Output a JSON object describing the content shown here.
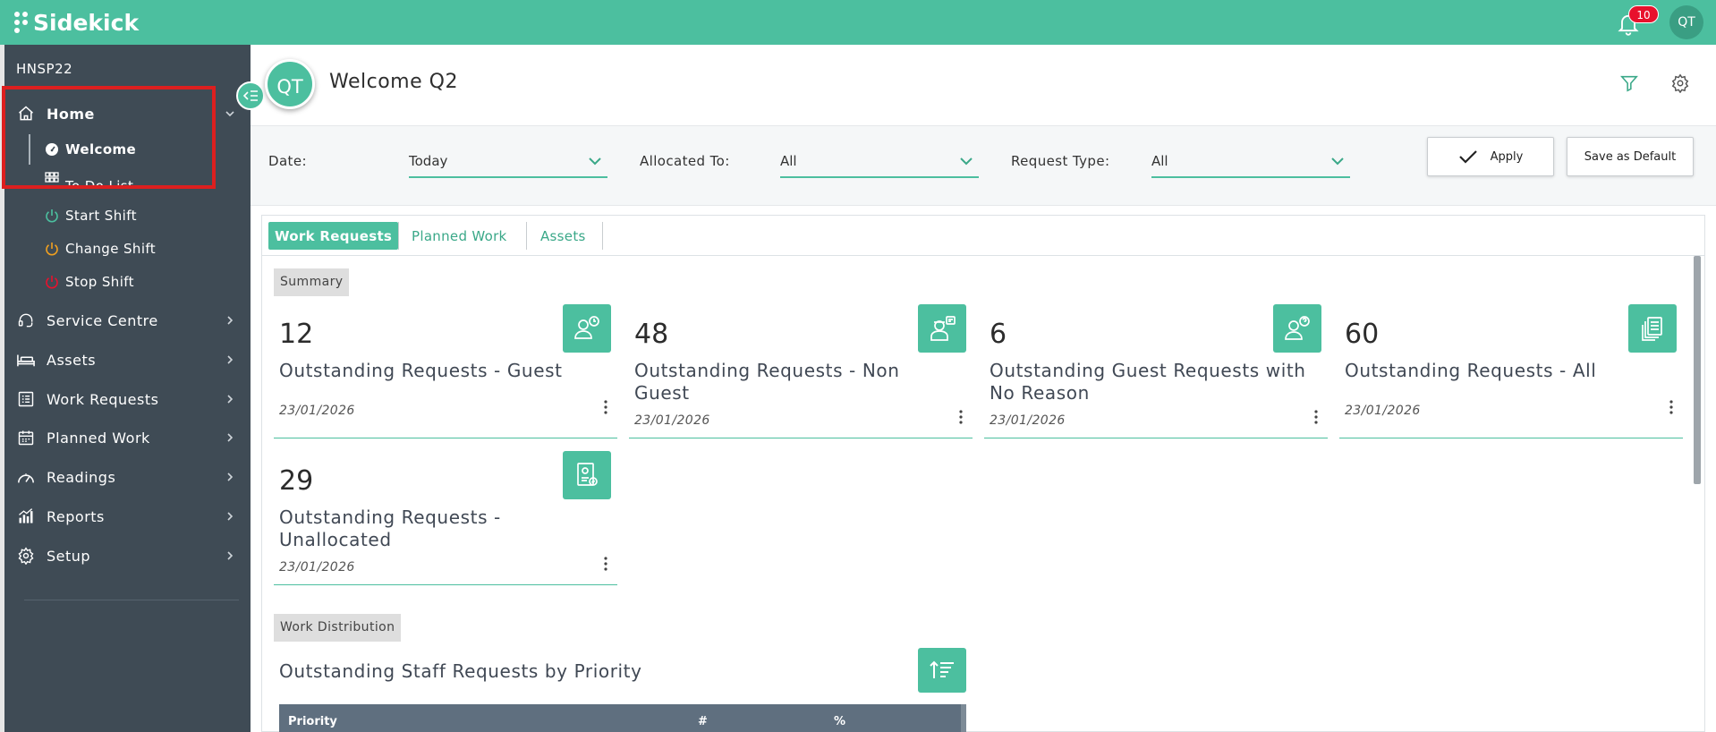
{
  "app": {
    "name": "Sidekick",
    "notification_count": "10",
    "user_initials": "QT"
  },
  "sidebar": {
    "site_code": "HNSP22",
    "home": {
      "label": "Home",
      "icon": "home-icon"
    },
    "home_sub": [
      {
        "label": "Welcome",
        "icon": "dashboard-gauge-icon",
        "icon_color": "#ffffff"
      },
      {
        "label": "To Do List",
        "icon": "grid-list-icon",
        "icon_color": "#ffffff"
      },
      {
        "label": "Start Shift",
        "icon": "power-icon",
        "icon_color": "#4cbf9f"
      },
      {
        "label": "Change Shift",
        "icon": "power-icon",
        "icon_color": "#f0a020"
      },
      {
        "label": "Stop Shift",
        "icon": "power-icon",
        "icon_color": "#e8112d"
      }
    ],
    "items": [
      {
        "label": "Service Centre",
        "icon": "headset-icon"
      },
      {
        "label": "Assets",
        "icon": "bed-icon"
      },
      {
        "label": "Work Requests",
        "icon": "list-icon"
      },
      {
        "label": "Planned Work",
        "icon": "calendar-icon"
      },
      {
        "label": "Readings",
        "icon": "gauge-icon"
      },
      {
        "label": "Reports",
        "icon": "bar-chart-icon"
      },
      {
        "label": "Setup",
        "icon": "gear-icon"
      }
    ]
  },
  "header": {
    "avatar_initials": "QT",
    "title": "Welcome Q2"
  },
  "filters": {
    "date": {
      "label": "Date:",
      "value": "Today"
    },
    "allocated": {
      "label": "Allocated To:",
      "value": "All"
    },
    "request_type": {
      "label": "Request Type:",
      "value": "All"
    },
    "apply_label": "Apply",
    "save_default_label": "Save as Default"
  },
  "tabs": [
    {
      "label": "Work Requests",
      "active": true
    },
    {
      "label": "Planned Work",
      "active": false
    },
    {
      "label": "Assets",
      "active": false
    }
  ],
  "summary": {
    "tag": "Summary",
    "cards": [
      {
        "count": "12",
        "title": "Outstanding Requests - Guest",
        "date": "23/01/2026",
        "icon": "guest-clock-icon"
      },
      {
        "count": "48",
        "title": "Outstanding Requests - Non Guest",
        "date": "23/01/2026",
        "icon": "staff-note-icon"
      },
      {
        "count": "6",
        "title": "Outstanding Guest Requests with No Reason",
        "date": "23/01/2026",
        "icon": "guest-question-icon"
      },
      {
        "count": "60",
        "title": "Outstanding Requests - All",
        "date": "23/01/2026",
        "icon": "documents-icon"
      },
      {
        "count": "29",
        "title": "Outstanding Requests - Unallocated",
        "date": "23/01/2026",
        "icon": "id-badge-icon"
      }
    ]
  },
  "work_distribution": {
    "tag": "Work Distribution",
    "title": "Outstanding Staff Requests by Priority",
    "columns": [
      "Priority",
      "#",
      "%"
    ]
  },
  "colors": {
    "brand": "#4cbf9f",
    "sidebar": "#3f4b55",
    "alert": "#e8112d",
    "highlight_box": "#dd1f1f"
  }
}
